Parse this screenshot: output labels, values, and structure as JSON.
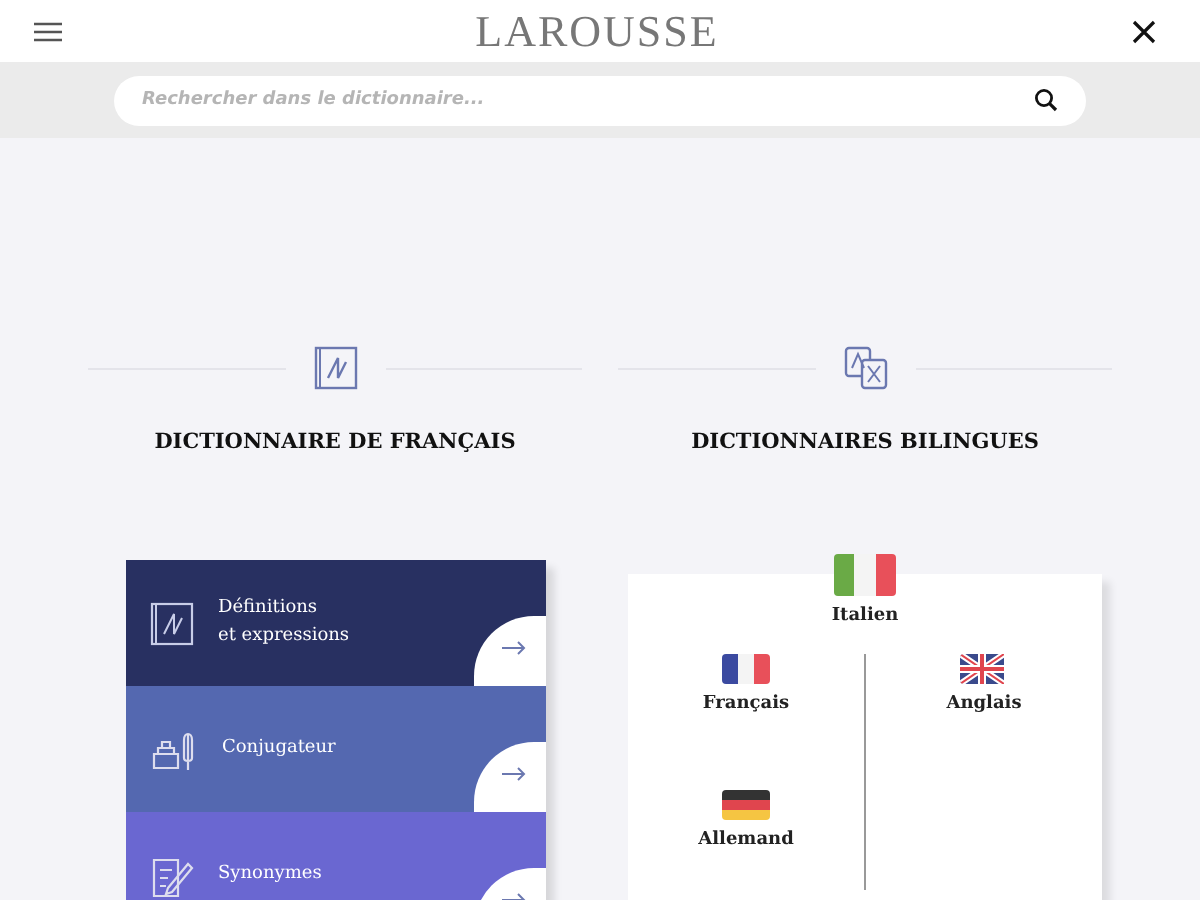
{
  "header": {
    "logo": "LAROUSSE"
  },
  "search": {
    "placeholder": "Rechercher dans le dictionnaire..."
  },
  "sections": [
    {
      "kind": "dictionary",
      "title": "DICTIONNAIRE DE FRANÇAIS"
    },
    {
      "kind": "translate",
      "title": "DICTIONNAIRES BILINGUES"
    }
  ],
  "french_menu": [
    {
      "kind": "definitions",
      "label": "Définitions\net expressions",
      "color": "#283061"
    },
    {
      "kind": "conjugation",
      "label": "Conjugateur",
      "color": "#5468b0"
    },
    {
      "kind": "synonyms",
      "label": "Synonymes",
      "color": "#6a67d1"
    }
  ],
  "bilingual": {
    "featured": {
      "kind": "it",
      "label": "Italien"
    },
    "columns": [
      [
        {
          "kind": "fr",
          "label": "Français"
        },
        {
          "kind": "de",
          "label": "Allemand"
        }
      ],
      [
        {
          "kind": "gb",
          "label": "Anglais"
        }
      ]
    ]
  }
}
